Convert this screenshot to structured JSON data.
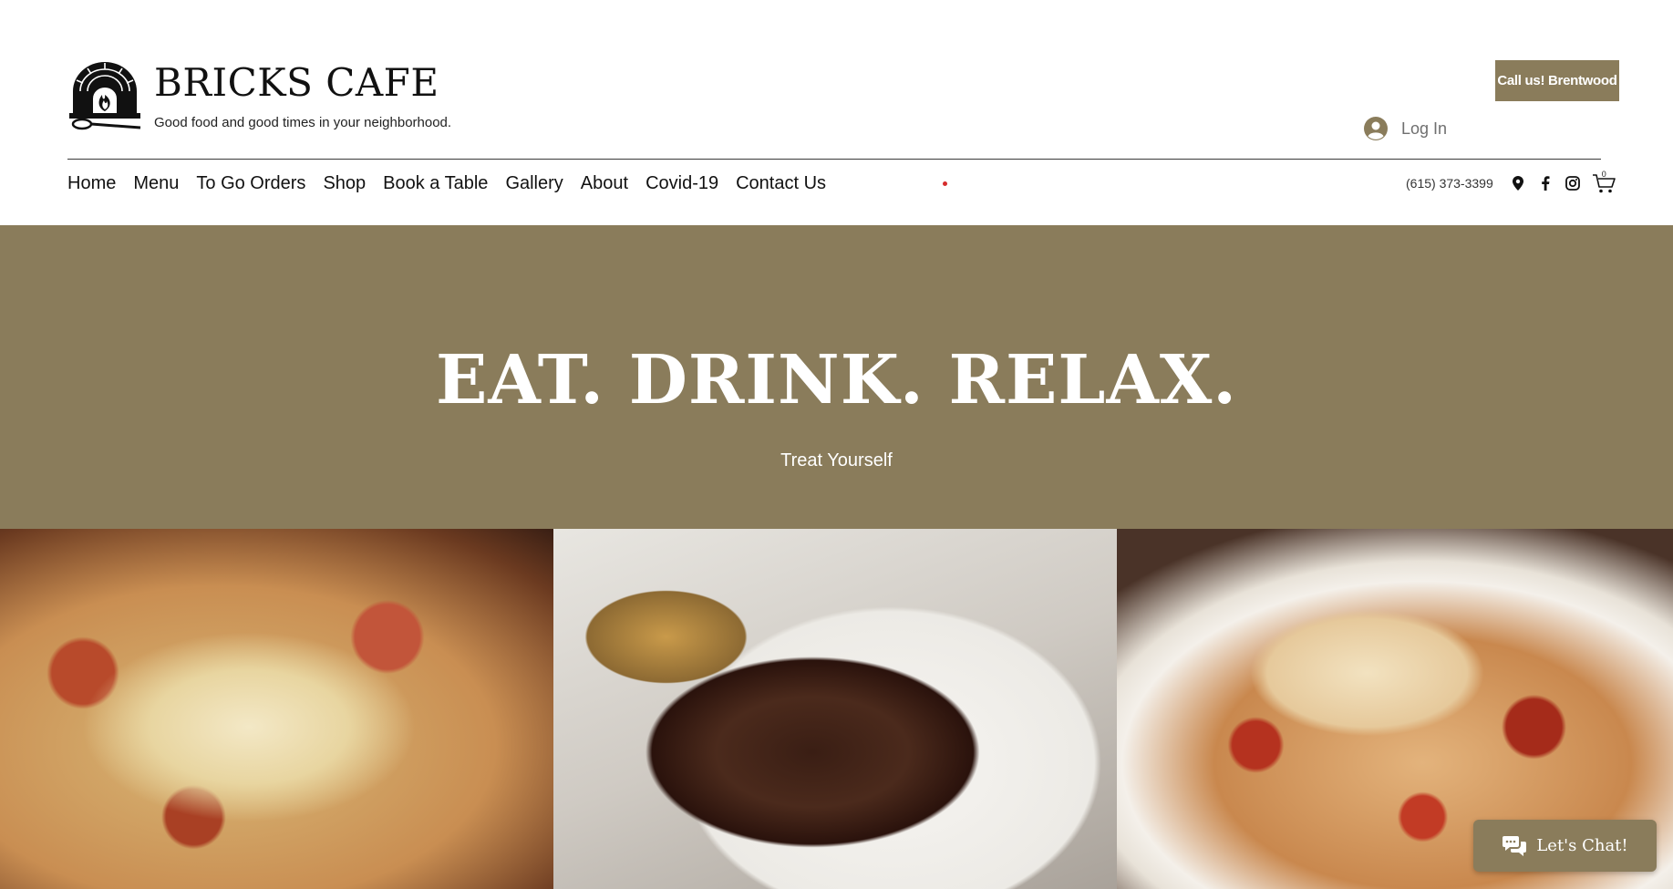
{
  "header": {
    "brand_name": "BRICKS CAFE",
    "tagline": "Good food and good times in your neighborhood.",
    "call_button_label": "Call us! Brentwood",
    "login_label": "Log In",
    "logo_icon": "brick-oven-logo-icon"
  },
  "nav": {
    "items": [
      {
        "label": "Home"
      },
      {
        "label": "Menu"
      },
      {
        "label": "To Go Orders"
      },
      {
        "label": "Shop"
      },
      {
        "label": "Book a Table"
      },
      {
        "label": "Gallery"
      },
      {
        "label": "About"
      },
      {
        "label": "Covid-19"
      },
      {
        "label": "Contact Us"
      }
    ]
  },
  "contact": {
    "phone": "(615) 373-3399",
    "icons": [
      "map-pin-icon",
      "facebook-icon",
      "instagram-icon",
      "cart-icon"
    ],
    "cart_count": "0"
  },
  "hero": {
    "title": "EAT. DRINK. RELAX.",
    "subtitle": "Treat Yourself",
    "background_color": "#8a7c5b"
  },
  "gallery": {
    "photos": [
      "pizza-photo",
      "steak-photo",
      "pasta-photo"
    ]
  },
  "chat": {
    "label": "Let's Chat!",
    "icon": "chat-bubbles-icon"
  },
  "colors": {
    "accent": "#8a7c5b",
    "text": "#111111",
    "nav_dot": "#d62c2c"
  }
}
